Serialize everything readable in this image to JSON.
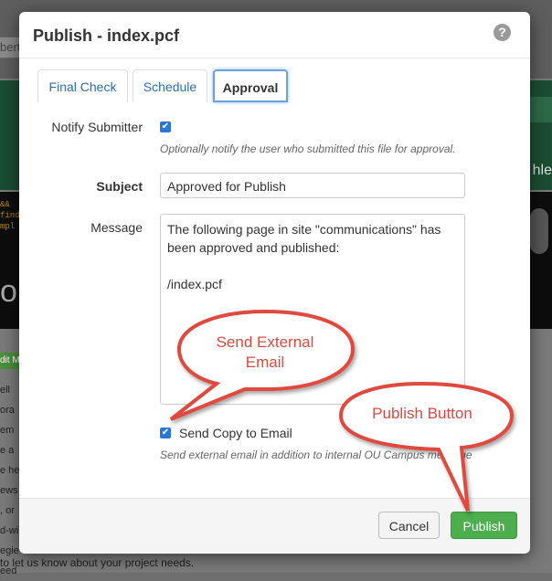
{
  "background": {
    "input_fragment": "bert",
    "side_text": "hle",
    "big_text": "o",
    "code_lines": [
      "&&",
      "find",
      "mpl"
    ],
    "edit_button": "dit M",
    "text_fragments": [
      "ell",
      "ora",
      "em",
      "e a",
      "e he",
      "ews",
      ", or",
      "d-wi",
      "egie",
      "eed"
    ],
    "footer_text": "to let us know about your project needs."
  },
  "modal": {
    "title": "Publish - index.pcf",
    "help_icon": "?",
    "tabs": [
      {
        "label": "Final Check",
        "active": false
      },
      {
        "label": "Schedule",
        "active": false
      },
      {
        "label": "Approval",
        "active": true
      }
    ],
    "notify_label": "Notify Submitter",
    "notify_checked": true,
    "notify_help": "Optionally notify the user who submitted this file for approval.",
    "subject_label": "Subject",
    "subject_value": "Approved for Publish",
    "message_label": "Message",
    "message_value": "The following page in site \"communications\" has been approved and published:\n\n/index.pcf",
    "copy_checked": true,
    "copy_label": "Send Copy to Email",
    "copy_help": "Send external email in addition to internal OU Campus message",
    "cancel_label": "Cancel",
    "publish_label": "Publish"
  },
  "callouts": {
    "email": "Send External Email",
    "publish": "Publish Button",
    "color": "#e0483e"
  },
  "colors": {
    "publish_button": "#4cae4c",
    "checkbox": "#2a78d6",
    "active_tab_border": "#6aa3dd"
  }
}
